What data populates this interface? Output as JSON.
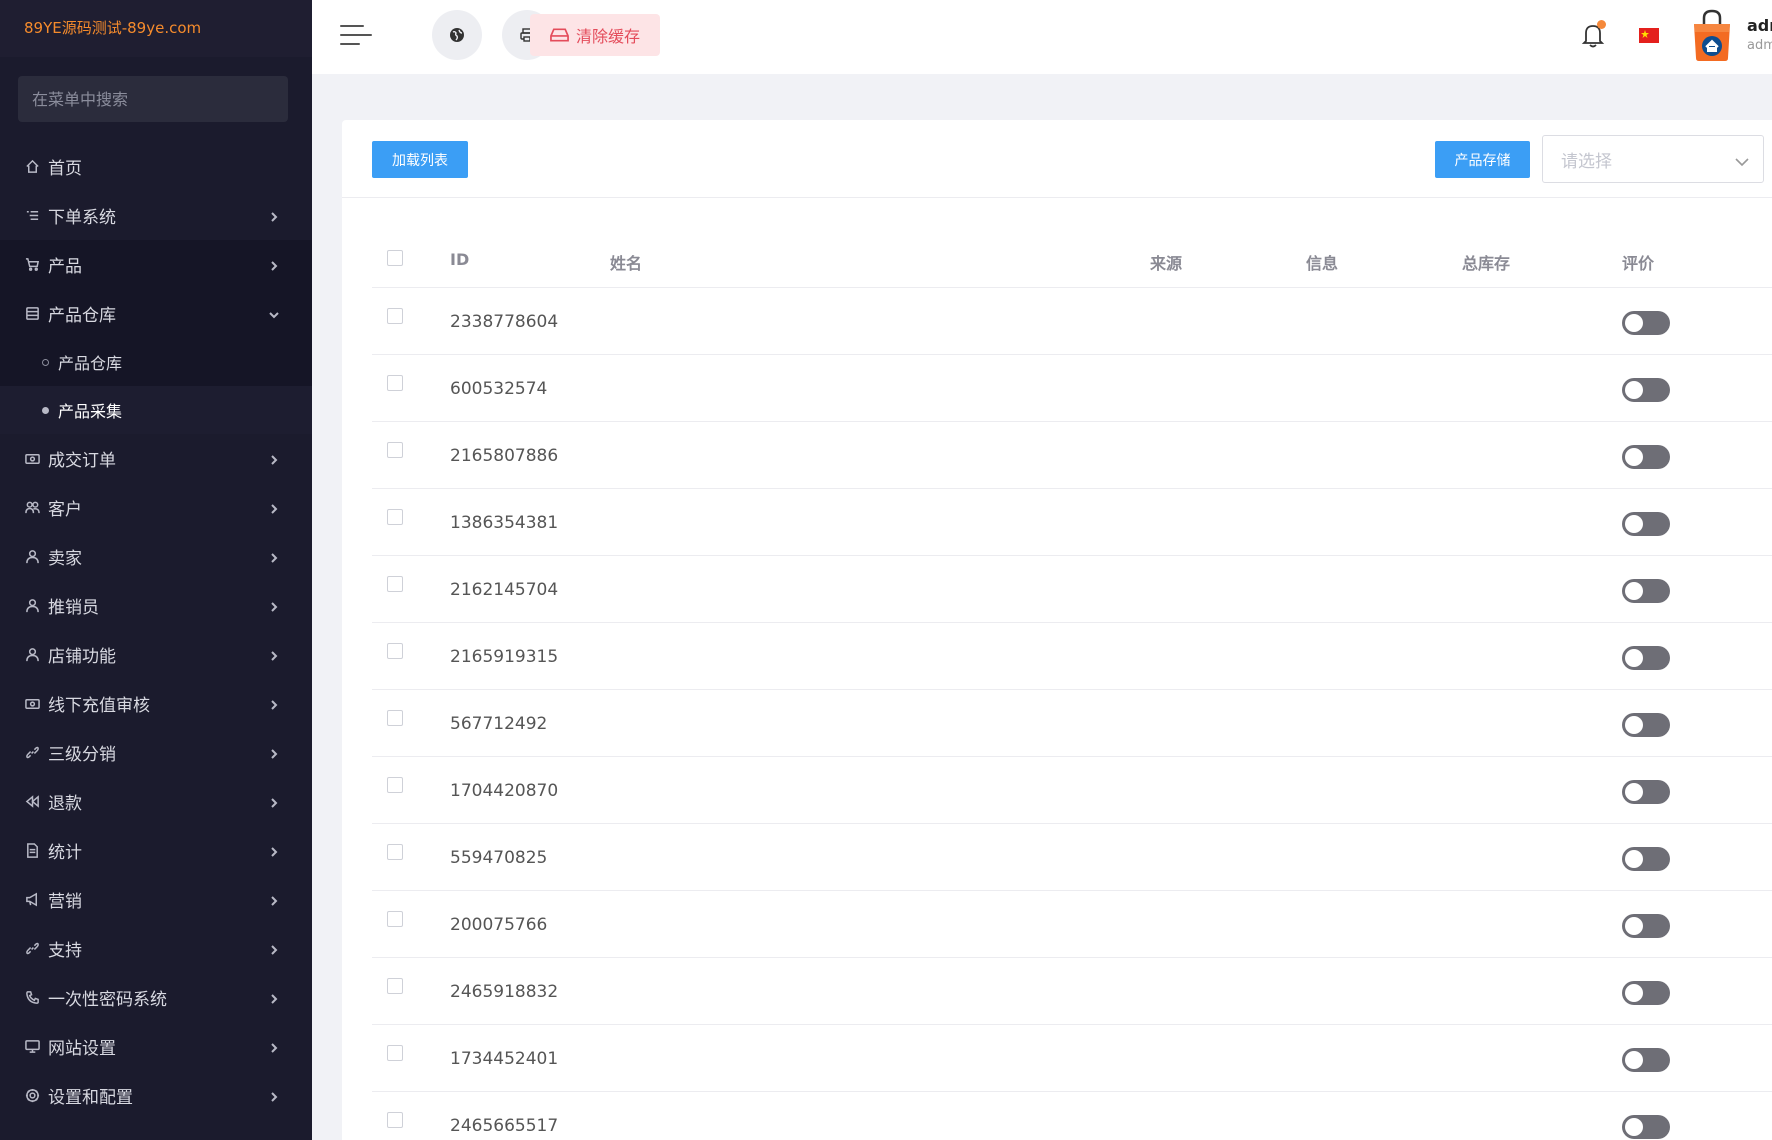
{
  "sidebar": {
    "brand": "89YE源码测试-89ye.com",
    "search_placeholder": "在菜单中搜索",
    "items": [
      {
        "label": "首页",
        "icon": "home-icon",
        "has_chevron": false
      },
      {
        "label": "下单系统",
        "icon": "list-icon",
        "has_chevron": true
      },
      {
        "label": "产品",
        "icon": "cart-icon",
        "has_chevron": true
      },
      {
        "label": "产品仓库",
        "icon": "warehouse-icon",
        "has_chevron": true,
        "expanded": true
      },
      {
        "label": "成交订单",
        "icon": "money-icon",
        "has_chevron": true
      },
      {
        "label": "客户",
        "icon": "users-icon",
        "has_chevron": true
      },
      {
        "label": "卖家",
        "icon": "user-icon",
        "has_chevron": true
      },
      {
        "label": "推销员",
        "icon": "user-icon",
        "has_chevron": true
      },
      {
        "label": "店铺功能",
        "icon": "user-icon",
        "has_chevron": true
      },
      {
        "label": "线下充值审核",
        "icon": "money-icon",
        "has_chevron": true
      },
      {
        "label": "三级分销",
        "icon": "link-icon",
        "has_chevron": true
      },
      {
        "label": "退款",
        "icon": "rewind-icon",
        "has_chevron": true
      },
      {
        "label": "统计",
        "icon": "file-icon",
        "has_chevron": true
      },
      {
        "label": "营销",
        "icon": "megaphone-icon",
        "has_chevron": true
      },
      {
        "label": "支持",
        "icon": "link-icon",
        "has_chevron": true
      },
      {
        "label": "一次性密码系统",
        "icon": "phone-icon",
        "has_chevron": true
      },
      {
        "label": "网站设置",
        "icon": "monitor-icon",
        "has_chevron": true
      },
      {
        "label": "设置和配置",
        "icon": "gear-icon",
        "has_chevron": true
      }
    ],
    "sub_items": [
      {
        "label": "产品仓库",
        "current": false
      },
      {
        "label": "产品采集",
        "current": true
      }
    ]
  },
  "header": {
    "clear_cache_label": "清除缓存",
    "user_name": "adr",
    "user_role": "adm",
    "colors": {
      "notification_dot": "#f5893b",
      "clear_cache_text": "#e44c5b"
    }
  },
  "toolbar": {
    "load_list_label": "加载列表",
    "product_storage_label": "产品存储",
    "select_placeholder": "请选择"
  },
  "table": {
    "columns": {
      "id": "ID",
      "name": "姓名",
      "source": "来源",
      "info": "信息",
      "total_stock": "总库存",
      "review": "评价"
    },
    "rows": [
      {
        "id": "2338778604"
      },
      {
        "id": "600532574"
      },
      {
        "id": "2165807886"
      },
      {
        "id": "1386354381"
      },
      {
        "id": "2162145704"
      },
      {
        "id": "2165919315"
      },
      {
        "id": "567712492"
      },
      {
        "id": "1704420870"
      },
      {
        "id": "559470825"
      },
      {
        "id": "200075766"
      },
      {
        "id": "2465918832"
      },
      {
        "id": "1734452401"
      },
      {
        "id": "2465665517"
      }
    ]
  },
  "accent_color": "#3b9ef5"
}
